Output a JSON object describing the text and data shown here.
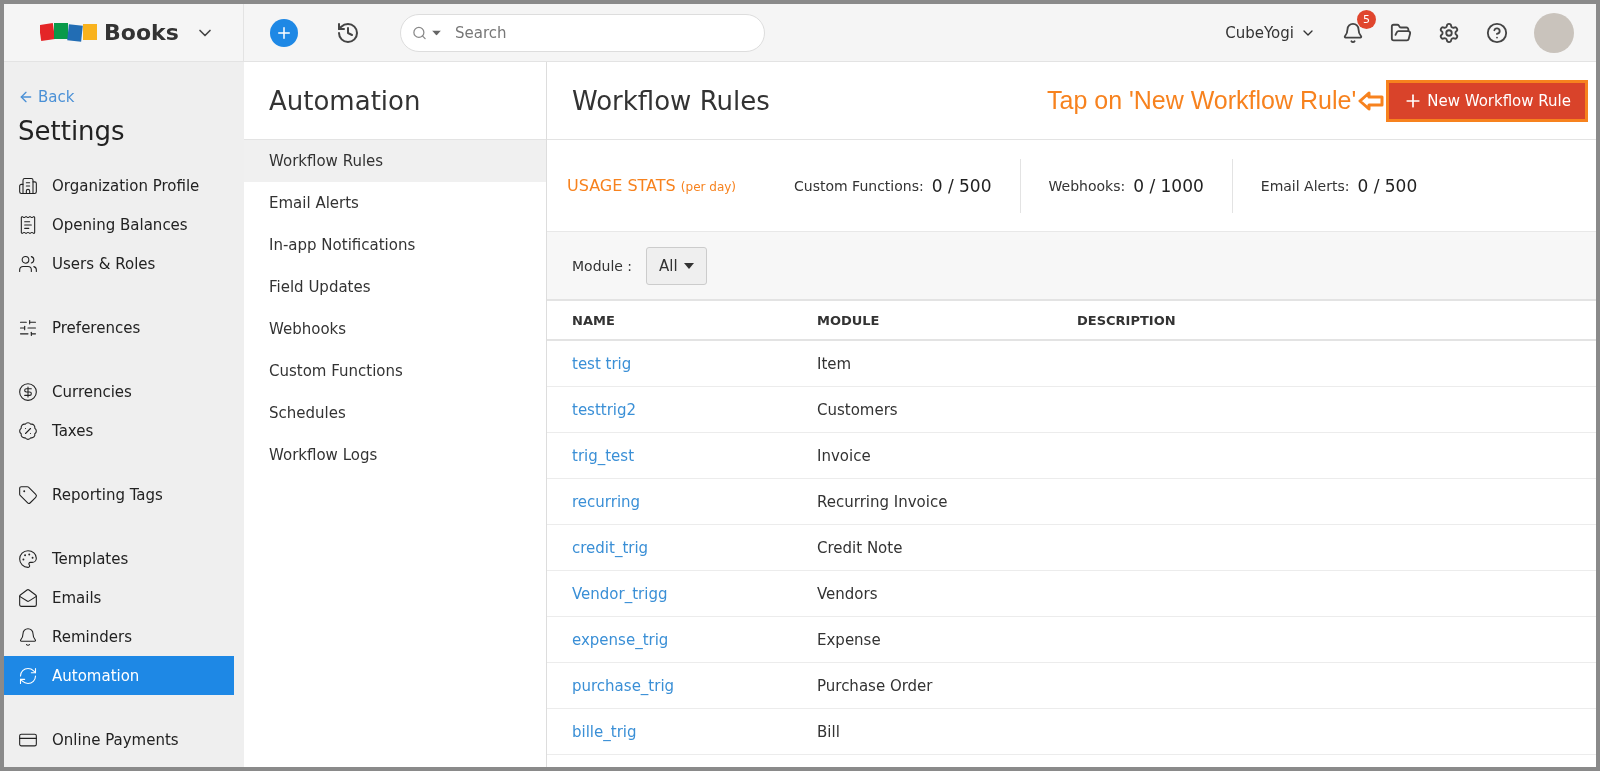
{
  "topbar": {
    "brand": "Books",
    "search": {
      "placeholder": "Search"
    },
    "org": "CubeYogi",
    "notification_count": "5"
  },
  "sidebar": {
    "back": "Back",
    "title": "Settings",
    "groups": [
      {
        "items": [
          {
            "label": "Organization Profile",
            "selected": false
          },
          {
            "label": "Opening Balances",
            "selected": false
          },
          {
            "label": "Users & Roles",
            "selected": false
          }
        ]
      },
      {
        "items": [
          {
            "label": "Preferences",
            "selected": false
          }
        ]
      },
      {
        "items": [
          {
            "label": "Currencies",
            "selected": false
          },
          {
            "label": "Taxes",
            "selected": false
          }
        ]
      },
      {
        "items": [
          {
            "label": "Reporting Tags",
            "selected": false
          }
        ]
      },
      {
        "items": [
          {
            "label": "Templates",
            "selected": false
          },
          {
            "label": "Emails",
            "selected": false
          },
          {
            "label": "Reminders",
            "selected": false
          },
          {
            "label": "Automation",
            "selected": true
          }
        ]
      },
      {
        "items": [
          {
            "label": "Online Payments",
            "selected": false
          }
        ]
      }
    ]
  },
  "subnav": {
    "title": "Automation",
    "items": [
      {
        "label": "Workflow Rules",
        "selected": true
      },
      {
        "label": "Email Alerts",
        "selected": false
      },
      {
        "label": "In-app Notifications",
        "selected": false
      },
      {
        "label": "Field Updates",
        "selected": false
      },
      {
        "label": "Webhooks",
        "selected": false
      },
      {
        "label": "Custom Functions",
        "selected": false
      },
      {
        "label": "Schedules",
        "selected": false
      },
      {
        "label": "Workflow Logs",
        "selected": false
      }
    ]
  },
  "main": {
    "title": "Workflow Rules",
    "annotation": "Tap on 'New Workflow Rule'",
    "new_button": "New Workflow Rule",
    "usage": {
      "title": "USAGE STATS",
      "subtitle": "(per day)",
      "stats": [
        {
          "label": "Custom Functions:",
          "value": "0 / 500"
        },
        {
          "label": "Webhooks:",
          "value": "0 / 1000"
        },
        {
          "label": "Email Alerts:",
          "value": "0 / 500"
        }
      ]
    },
    "filter": {
      "label": "Module :",
      "value": "All"
    },
    "table": {
      "columns": [
        "NAME",
        "MODULE",
        "DESCRIPTION"
      ],
      "rows": [
        [
          "test trig",
          "Item"
        ],
        [
          "testtrig2",
          "Customers"
        ],
        [
          "trig_test",
          "Invoice"
        ],
        [
          "recurring",
          "Recurring Invoice"
        ],
        [
          "credit_trig",
          "Credit Note"
        ],
        [
          "Vendor_trigg",
          "Vendors"
        ],
        [
          "expense_trig",
          "Expense"
        ],
        [
          "purchase_trig",
          "Purchase Order"
        ],
        [
          "bille_trig",
          "Bill"
        ]
      ]
    }
  }
}
